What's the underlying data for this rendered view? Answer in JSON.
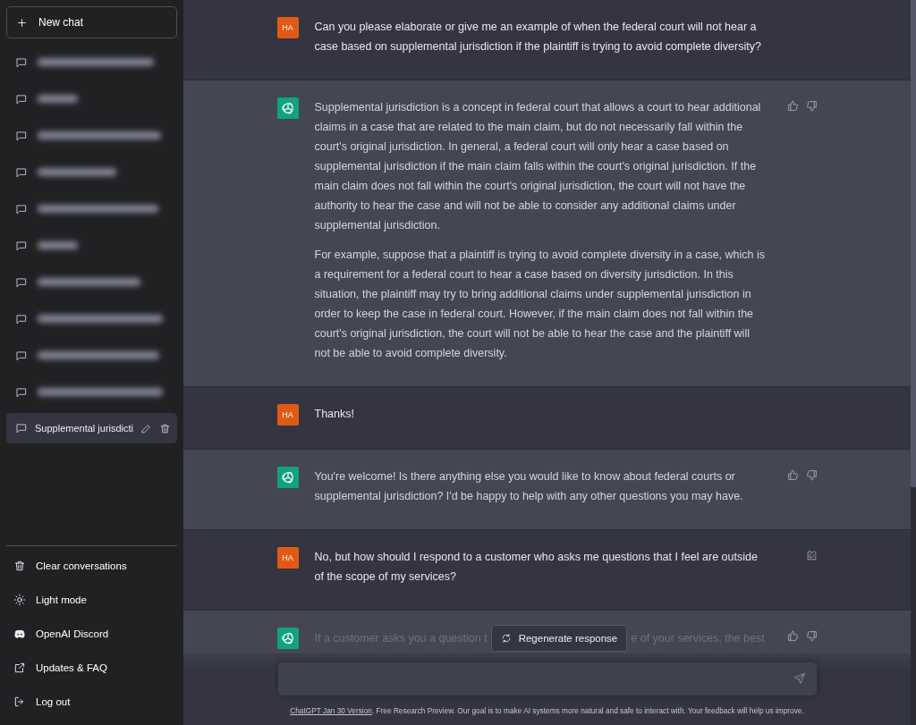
{
  "sidebar": {
    "new_chat": {
      "label": "New chat"
    },
    "history": [
      {
        "kind": "blurred",
        "selected": false
      },
      {
        "kind": "blurred",
        "selected": false
      },
      {
        "kind": "blurred",
        "selected": false
      },
      {
        "kind": "blurred",
        "selected": false
      },
      {
        "kind": "blurred",
        "selected": false
      },
      {
        "kind": "blurred",
        "selected": false
      },
      {
        "kind": "blurred",
        "selected": false
      },
      {
        "kind": "blurred",
        "selected": false
      },
      {
        "kind": "blurred",
        "selected": false
      },
      {
        "kind": "blurred",
        "selected": false
      },
      {
        "kind": "titled",
        "title": "Supplemental jurisdicti",
        "selected": true
      }
    ],
    "menu": [
      {
        "kind": "trash",
        "label": "Clear conversations"
      },
      {
        "kind": "sun",
        "label": "Light mode"
      },
      {
        "kind": "discord",
        "label": "OpenAI Discord"
      },
      {
        "kind": "external",
        "label": "Updates & FAQ"
      },
      {
        "kind": "logout",
        "label": "Log out"
      }
    ]
  },
  "messages": [
    {
      "kind": "user",
      "avatar": "HA",
      "edit_visible": false,
      "paragraphs": [
        "Can you please elaborate or give me an example of when the federal court will not hear a case based on supplemental jurisdiction if the plaintiff is trying to avoid complete diversity?"
      ]
    },
    {
      "kind": "assistant",
      "paragraphs": [
        "Supplemental jurisdiction is a concept in federal court that allows a court to hear additional claims in a case that are related to the main claim, but do not necessarily fall within the court's original jurisdiction. In general, a federal court will only hear a case based on supplemental jurisdiction if the main claim falls within the court's original jurisdiction. If the main claim does not fall within the court's original jurisdiction, the court will not have the authority to hear the case and will not be able to consider any additional claims under supplemental jurisdiction.",
        "For example, suppose that a plaintiff is trying to avoid complete diversity in a case, which is a requirement for a federal court to hear a case based on diversity jurisdiction. In this situation, the plaintiff may try to bring additional claims under supplemental jurisdiction in order to keep the case in federal court. However, if the main claim does not fall within the court's original jurisdiction, the court will not be able to hear the case and the plaintiff will not be able to avoid complete diversity."
      ]
    },
    {
      "kind": "user",
      "avatar": "HA",
      "edit_visible": false,
      "paragraphs": [
        "Thanks!"
      ]
    },
    {
      "kind": "assistant",
      "paragraphs": [
        "You're welcome! Is there anything else you would like to know about federal courts or supplemental jurisdiction? I'd be happy to help with any other questions you may have."
      ]
    },
    {
      "kind": "user",
      "avatar": "HA",
      "edit_visible": true,
      "paragraphs": [
        "No, but how should I respond to a customer who asks me questions that I feel are outside of the scope of my services?"
      ]
    },
    {
      "kind": "assistant",
      "partial": [
        "If a customer asks you a question t",
        "e of your services, the best"
      ]
    }
  ],
  "regenerate": {
    "label": "Regenerate response"
  },
  "footer": {
    "link": "ChatGPT Jan 30 Version",
    "text": ". Free Research Preview. Our goal is to make AI systems more natural and safe to interact with. Your feedback will help us improve."
  }
}
